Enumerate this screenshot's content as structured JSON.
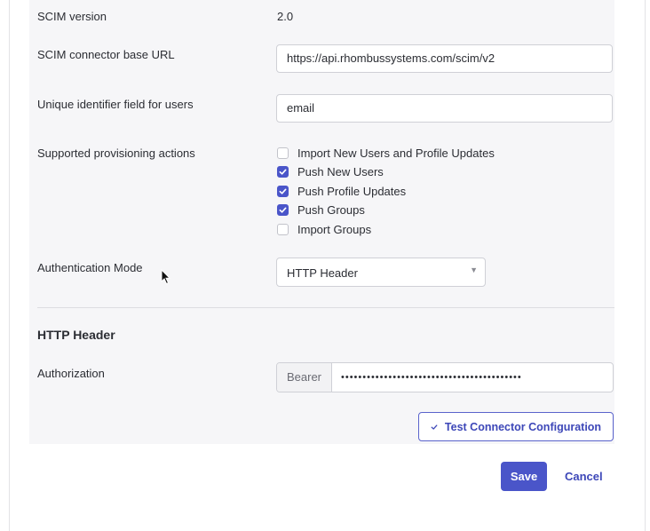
{
  "form": {
    "scim_version_label": "SCIM version",
    "scim_version_value": "2.0",
    "base_url_label": "SCIM connector base URL",
    "base_url_value": "https://api.rhombussystems.com/scim/v2",
    "unique_id_label": "Unique identifier field for users",
    "unique_id_value": "email",
    "actions_label": "Supported provisioning actions",
    "actions": [
      {
        "label": "Import New Users and Profile Updates",
        "checked": false
      },
      {
        "label": "Push New Users",
        "checked": true
      },
      {
        "label": "Push Profile Updates",
        "checked": true
      },
      {
        "label": "Push Groups",
        "checked": true
      },
      {
        "label": "Import Groups",
        "checked": false
      }
    ],
    "auth_mode_label": "Authentication Mode",
    "auth_mode_value": "HTTP Header"
  },
  "header_section": {
    "title": "HTTP Header",
    "authorization_label": "Authorization",
    "bearer_prefix": "Bearer",
    "token_masked": "••••••••••••••••••••••••••••••••••••••••••"
  },
  "buttons": {
    "test_label": "Test Connector Configuration",
    "save_label": "Save",
    "cancel_label": "Cancel"
  },
  "colors": {
    "accent": "#4a55c9",
    "panel_bg": "#f6f6f8"
  }
}
